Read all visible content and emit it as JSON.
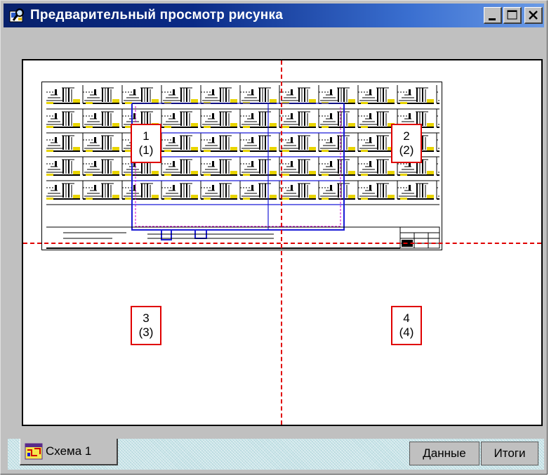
{
  "window": {
    "title": "Предварительный просмотр рисунка",
    "icon": "preview-app-icon",
    "controls": [
      "minimize",
      "maximize",
      "close"
    ]
  },
  "pages": [
    {
      "number": "1",
      "sub": "(1)"
    },
    {
      "number": "2",
      "sub": "(2)"
    },
    {
      "number": "3",
      "sub": "(3)"
    },
    {
      "number": "4",
      "sub": "(4)"
    }
  ],
  "tabs": {
    "sheet": "Схема 1",
    "data": "Данные",
    "totals": "Итоги"
  },
  "colors": {
    "title_bar_start": "#08216b",
    "title_bar_end": "#6a9ae6",
    "page_split": "#e00000",
    "tab_area": "#c6e3e7",
    "drawing_blue": "#1b1bd6",
    "drawing_yellow": "#e8d400"
  }
}
